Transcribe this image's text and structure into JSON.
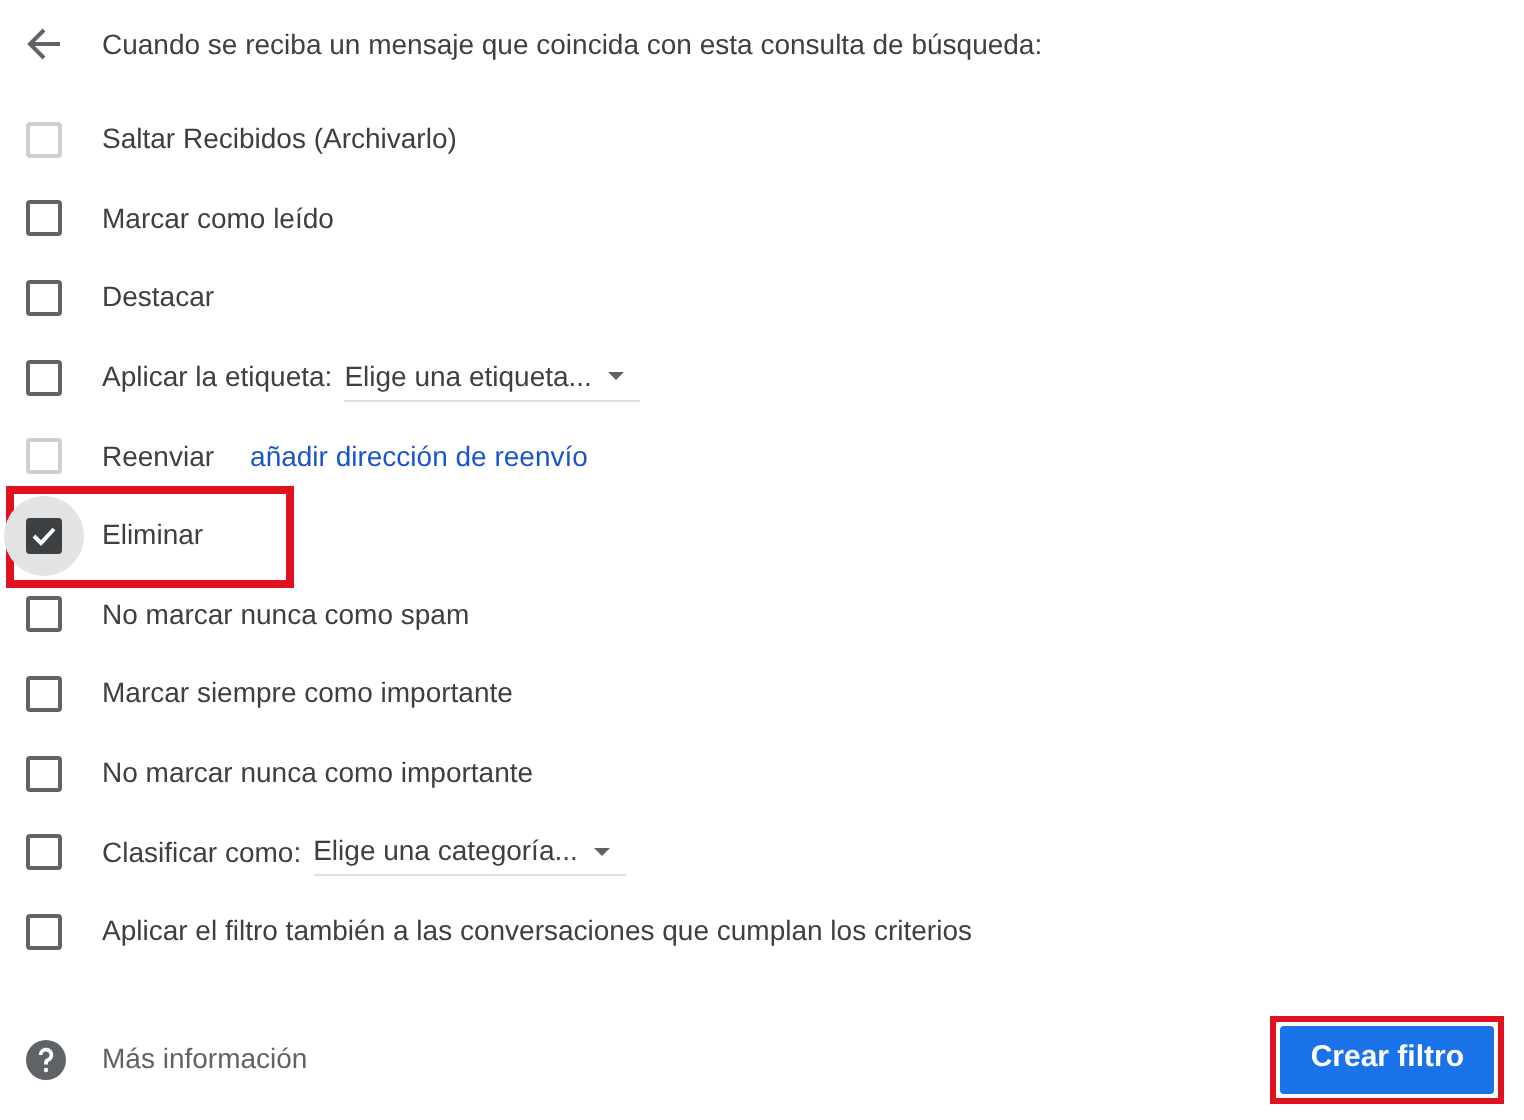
{
  "header": {
    "title": "Cuando se reciba un mensaje que coincida con esta consulta de búsqueda:"
  },
  "options": [
    {
      "kind": "plain",
      "label": "Saltar Recibidos (Archivarlo)",
      "checked": false,
      "disabled": true,
      "highlighted": false,
      "focused": false
    },
    {
      "kind": "plain",
      "label": "Marcar como leído",
      "checked": false,
      "disabled": false,
      "highlighted": false,
      "focused": false
    },
    {
      "kind": "plain",
      "label": "Destacar",
      "checked": false,
      "disabled": false,
      "highlighted": false,
      "focused": false
    },
    {
      "kind": "select",
      "label": "Aplicar la etiqueta:",
      "select": "Elige una etiqueta...",
      "checked": false,
      "disabled": false,
      "highlighted": false,
      "focused": false
    },
    {
      "kind": "link",
      "label": "Reenviar",
      "link": "añadir dirección de reenvío",
      "checked": false,
      "disabled": true,
      "highlighted": false,
      "focused": false
    },
    {
      "kind": "plain",
      "label": "Eliminar",
      "checked": true,
      "disabled": false,
      "highlighted": true,
      "focused": true
    },
    {
      "kind": "plain",
      "label": "No marcar nunca como spam",
      "checked": false,
      "disabled": false,
      "highlighted": false,
      "focused": false
    },
    {
      "kind": "plain",
      "label": "Marcar siempre como importante",
      "checked": false,
      "disabled": false,
      "highlighted": false,
      "focused": false
    },
    {
      "kind": "plain",
      "label": "No marcar nunca como importante",
      "checked": false,
      "disabled": false,
      "highlighted": false,
      "focused": false
    },
    {
      "kind": "select",
      "label": "Clasificar como:",
      "select": "Elige una categoría...",
      "checked": false,
      "disabled": false,
      "highlighted": false,
      "focused": false
    },
    {
      "kind": "plain",
      "label": "Aplicar el filtro también a las conversaciones que cumplan los criterios",
      "checked": false,
      "disabled": false,
      "highlighted": false,
      "focused": false
    }
  ],
  "footer": {
    "help": "Más información",
    "button": {
      "label": "Crear filtro",
      "highlighted": true
    }
  }
}
